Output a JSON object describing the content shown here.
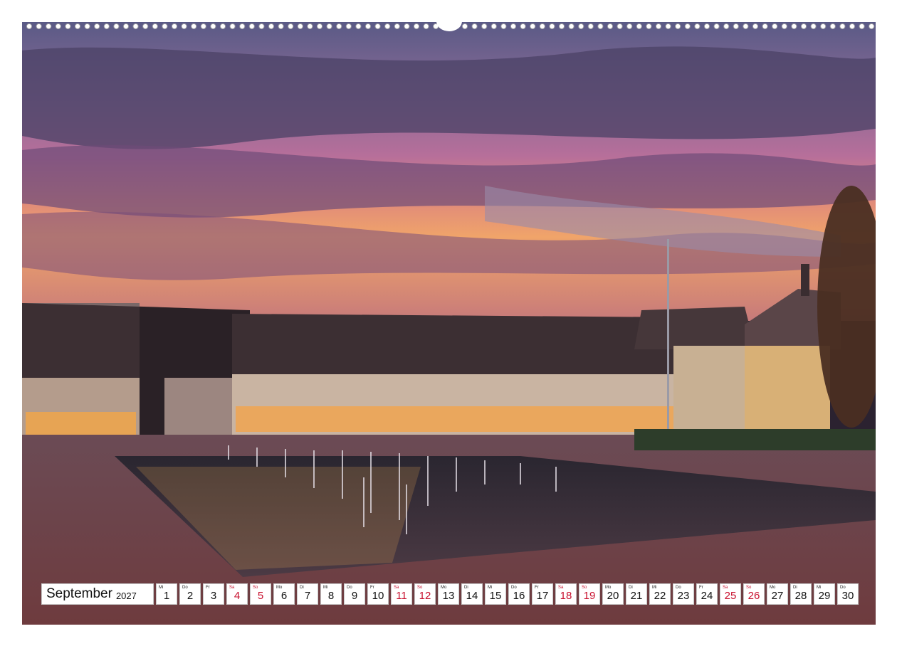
{
  "calendar": {
    "month": "September",
    "year": "2027",
    "days": [
      {
        "wd": "Mi",
        "n": "1",
        "we": false
      },
      {
        "wd": "Do",
        "n": "2",
        "we": false
      },
      {
        "wd": "Fr",
        "n": "3",
        "we": false
      },
      {
        "wd": "Sa",
        "n": "4",
        "we": true
      },
      {
        "wd": "So",
        "n": "5",
        "we": true
      },
      {
        "wd": "Mo",
        "n": "6",
        "we": false
      },
      {
        "wd": "Di",
        "n": "7",
        "we": false
      },
      {
        "wd": "Mi",
        "n": "8",
        "we": false
      },
      {
        "wd": "Do",
        "n": "9",
        "we": false
      },
      {
        "wd": "Fr",
        "n": "10",
        "we": false
      },
      {
        "wd": "Sa",
        "n": "11",
        "we": true
      },
      {
        "wd": "So",
        "n": "12",
        "we": true
      },
      {
        "wd": "Mo",
        "n": "13",
        "we": false
      },
      {
        "wd": "Di",
        "n": "14",
        "we": false
      },
      {
        "wd": "Mi",
        "n": "15",
        "we": false
      },
      {
        "wd": "Do",
        "n": "16",
        "we": false
      },
      {
        "wd": "Fr",
        "n": "17",
        "we": false
      },
      {
        "wd": "Sa",
        "n": "18",
        "we": true
      },
      {
        "wd": "So",
        "n": "19",
        "we": true
      },
      {
        "wd": "Mo",
        "n": "20",
        "we": false
      },
      {
        "wd": "Di",
        "n": "21",
        "we": false
      },
      {
        "wd": "Mi",
        "n": "22",
        "we": false
      },
      {
        "wd": "Do",
        "n": "23",
        "we": false
      },
      {
        "wd": "Fr",
        "n": "24",
        "we": false
      },
      {
        "wd": "Sa",
        "n": "25",
        "we": true
      },
      {
        "wd": "So",
        "n": "26",
        "we": true
      },
      {
        "wd": "Mo",
        "n": "27",
        "we": false
      },
      {
        "wd": "Di",
        "n": "28",
        "we": false
      },
      {
        "wd": "Mi",
        "n": "29",
        "we": false
      },
      {
        "wd": "Do",
        "n": "30",
        "we": false
      }
    ]
  },
  "colors": {
    "weekend": "#c8102e",
    "weekday": "#111111"
  }
}
